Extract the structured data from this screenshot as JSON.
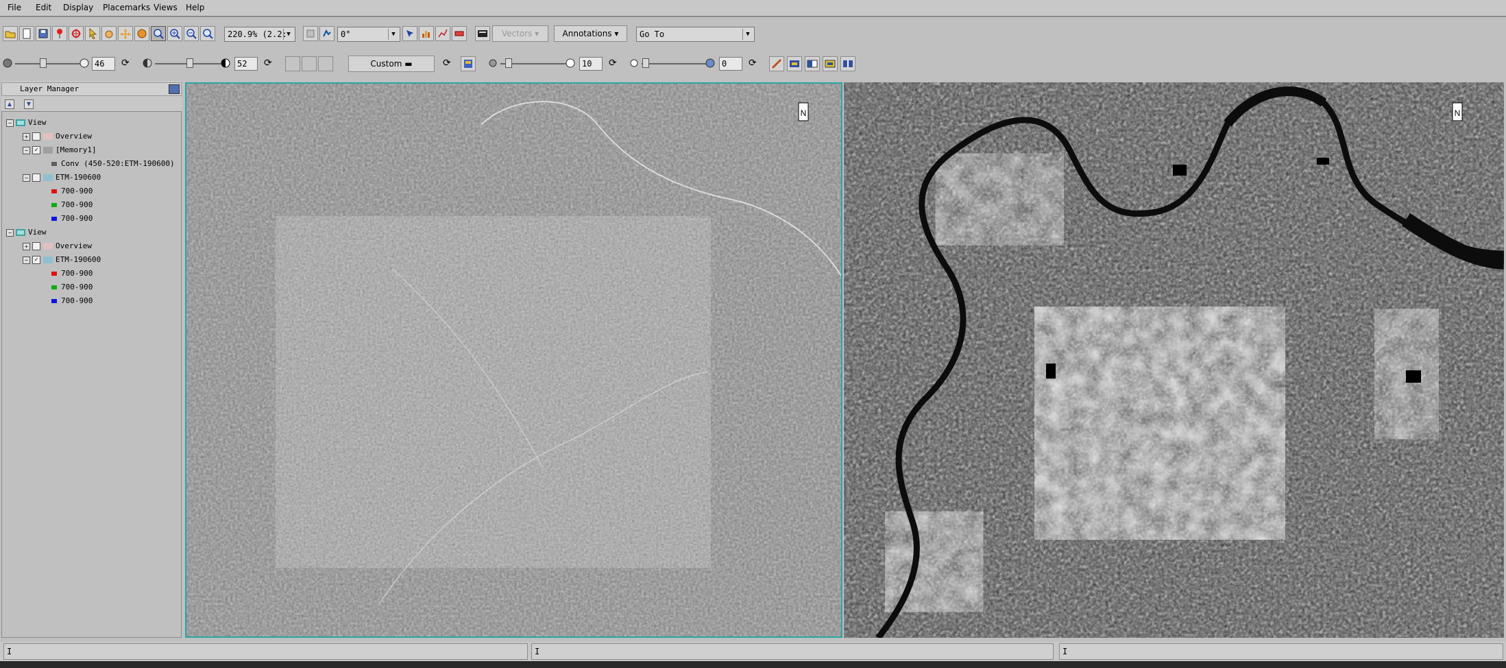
{
  "menu": [
    "File",
    "Edit",
    "Display",
    "Placemarks",
    "Views",
    "Help"
  ],
  "toolbar": {
    "zoom_value": "220.9% (2.2:",
    "rotation_value": "0°",
    "vectors_label": "Vectors",
    "annotations_label": "Annotations",
    "goto_value": "Go To"
  },
  "toolbar2": {
    "brightness": "46",
    "contrast": "52",
    "stretch_label": "Custom",
    "sharpen": "10",
    "transparency": "0"
  },
  "layer_manager": {
    "title": "Layer Manager",
    "tree": [
      {
        "label": "View",
        "level": 0,
        "type": "view"
      },
      {
        "label": "Overview",
        "level": 1,
        "type": "layer",
        "checked": false
      },
      {
        "label": "[Memory1]",
        "level": 1,
        "type": "layer",
        "checked": true
      },
      {
        "label": "Conv (450-520:ETM-190600)",
        "level": 2,
        "type": "band",
        "color": "#606060"
      },
      {
        "label": "ETM-190600",
        "level": 1,
        "type": "layer",
        "checked": false
      },
      {
        "label": "700-900",
        "level": 2,
        "type": "band",
        "color": "#dd1111"
      },
      {
        "label": "700-900",
        "level": 2,
        "type": "band",
        "color": "#11aa11"
      },
      {
        "label": "700-900",
        "level": 2,
        "type": "band",
        "color": "#1111dd"
      },
      {
        "label": "View",
        "level": 0,
        "type": "view"
      },
      {
        "label": "Overview",
        "level": 1,
        "type": "layer",
        "checked": false
      },
      {
        "label": "ETM-190600",
        "level": 1,
        "type": "layer",
        "checked": true
      },
      {
        "label": "700-900",
        "level": 2,
        "type": "band",
        "color": "#dd1111"
      },
      {
        "label": "700-900",
        "level": 2,
        "type": "band",
        "color": "#11aa11"
      },
      {
        "label": "700-900",
        "level": 2,
        "type": "band",
        "color": "#1111dd"
      }
    ]
  },
  "views": {
    "left_north": "N",
    "right_north": "N"
  },
  "status": [
    "I",
    "I",
    "I"
  ]
}
